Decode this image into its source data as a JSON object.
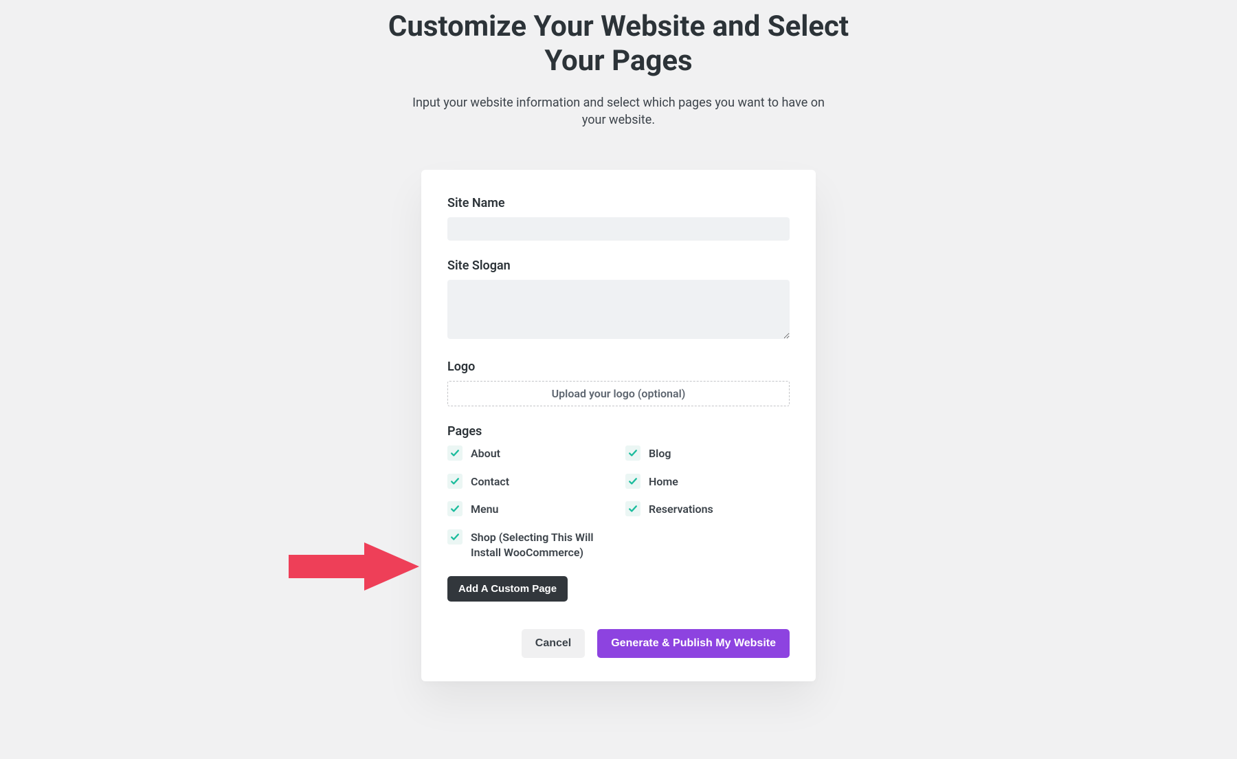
{
  "header": {
    "title": "Customize Your Website and Select Your Pages",
    "subtitle": "Input your website information and select which pages you want to have on your website."
  },
  "form": {
    "siteName": {
      "label": "Site Name",
      "value": ""
    },
    "siteSlogan": {
      "label": "Site Slogan",
      "value": ""
    },
    "logo": {
      "label": "Logo",
      "uploadText": "Upload your logo (optional)"
    },
    "pagesLabel": "Pages",
    "pages": [
      {
        "label": "About",
        "checked": true
      },
      {
        "label": "Blog",
        "checked": true
      },
      {
        "label": "Contact",
        "checked": true
      },
      {
        "label": "Home",
        "checked": true
      },
      {
        "label": "Menu",
        "checked": true
      },
      {
        "label": "Reservations",
        "checked": true
      },
      {
        "label": "Shop (Selecting This Will Install WooCommerce)",
        "checked": true
      }
    ],
    "addCustomLabel": "Add A Custom Page"
  },
  "actions": {
    "cancel": "Cancel",
    "publish": "Generate & Publish My Website"
  },
  "colors": {
    "accent_teal": "#1abc9c",
    "primary_purple": "#8d43e0",
    "arrow_red": "#ee3f58"
  },
  "annotation": {
    "type": "arrow-pointer",
    "points_to": "page-checkbox-shop"
  }
}
